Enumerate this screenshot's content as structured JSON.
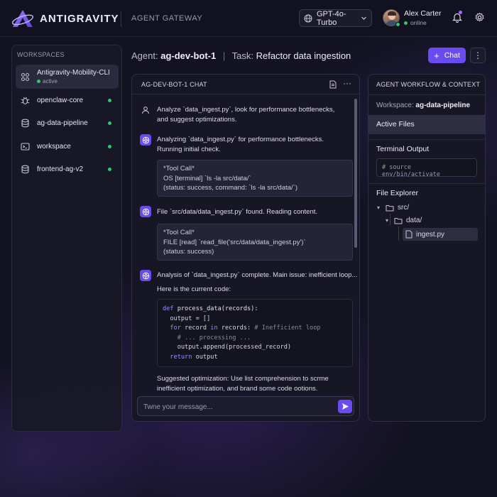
{
  "app": {
    "logo_text": "ANTIGRAVITY",
    "section": "AGENT GATEWAY",
    "model": "GPT-4o-Turbo",
    "user_name": "Alex Carter",
    "user_status": "online"
  },
  "sidebar": {
    "title": "WORKSPACES",
    "items": [
      {
        "name": "Antigravity-Mobility-CLI",
        "sub": "active",
        "icon": "grid-icon"
      },
      {
        "name": "openclaw-core",
        "icon": "bug-icon"
      },
      {
        "name": "ag-data-pipeline",
        "icon": "database-icon"
      },
      {
        "name": "workspace",
        "icon": "terminal-icon"
      },
      {
        "name": "frontend-ag-v2",
        "icon": "database-icon"
      }
    ]
  },
  "header": {
    "agent_label": "Agent:",
    "agent_name": "ag-dev-bot-1",
    "separator": "|",
    "task_label": "Task:",
    "task_name": "Refactor data ingestion",
    "new_chat_label": "Chat",
    "more_label": "⋮"
  },
  "chat": {
    "title": "AG-DEV-BOT-1 CHAT",
    "more": "···",
    "messages": [
      {
        "role": "user",
        "text": "Analyze `data_ingest.py`, look for performance bottlenecks, and suggest optimizations."
      },
      {
        "role": "bot",
        "text": "Analyzing `data_ingest.py` for performance bottlenecks. Running initial check."
      },
      {
        "role": "tool",
        "lines": [
          "*Tool Call*",
          "OS [terminal] `ls -la src/data/`",
          "(status: success, command: `ls -la src/data/`)"
        ]
      },
      {
        "role": "bot",
        "text": "File `src/data/data_ingest.py` found. Reading content."
      },
      {
        "role": "tool",
        "lines": [
          "*Tool Call*",
          "FILE [read] `read_file('src/data/data_ingest.py')`",
          "(status: success)"
        ]
      },
      {
        "role": "bot",
        "text": "Analysis of `data_ingest.py` complete. Main issue: inefficient loop...",
        "text2": "Here is the current code:"
      },
      {
        "role": "bot-cont",
        "text": "Suggested optimization: Use list comprehension to scrme inefficient optimization, and brand some code ootions."
      }
    ],
    "code": {
      "l1_kw": "def",
      "l1_rest": " process_data(records):",
      "l2": "  output = []",
      "l3_kw": "for",
      "l3_mid": " record ",
      "l3_kw2": "in",
      "l3_rest": " records: ",
      "l3_cm": "# Inefficient loop",
      "l4": "    # ... processing ...",
      "l5": "    output.append(processed_record)",
      "l6_kw": "return",
      "l6_rest": " output"
    },
    "input_placeholder": "Twne your message..."
  },
  "context": {
    "title": "AGENT WORKFLOW & CONTEXT",
    "workspace_label": "Workspace:",
    "workspace_value": "ag-data-pipeline",
    "active_files": "Active Files",
    "terminal_title": "Terminal Output",
    "terminal_line": "# source env/bin/activate",
    "explorer_title": "File Explorer",
    "tree": [
      "src/",
      "data/",
      "ingest.py"
    ]
  },
  "colors": {
    "accent": "#6a4bf0",
    "online": "#35c46a",
    "background": "#121220"
  }
}
